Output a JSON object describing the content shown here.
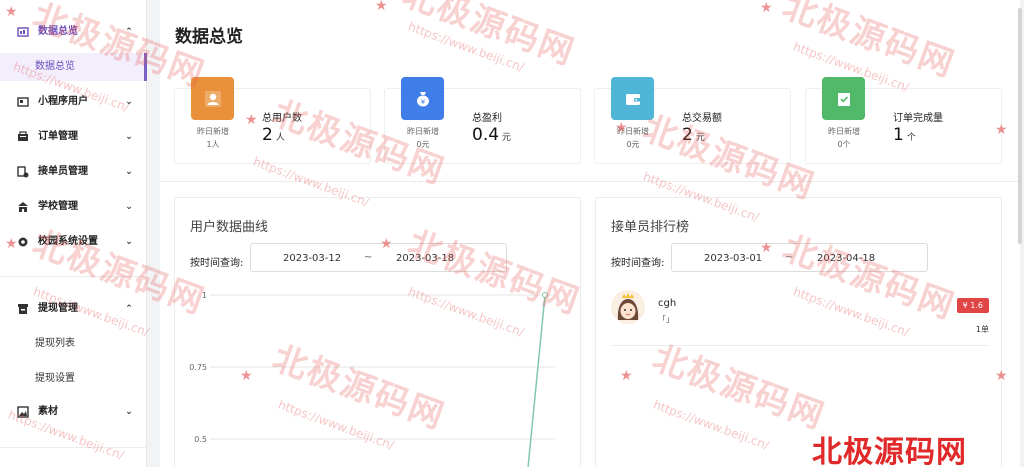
{
  "sidebar": {
    "dashboard_label": "数据总览",
    "dashboard_sub_label": "数据总览",
    "mini_users_label": "小程序用户",
    "orders_label": "订单管理",
    "couriers_label": "接单员管理",
    "schools_label": "学校管理",
    "campus_settings_label": "校园系统设置",
    "withdraw_label": "提现管理",
    "withdraw_list_label": "提现列表",
    "withdraw_settings_label": "提现设置",
    "materials_label": "素材"
  },
  "page": {
    "title": "数据总览"
  },
  "stats": [
    {
      "title": "总用户数",
      "value": "2",
      "unit": "人",
      "sub_label": "昨日新增",
      "sub_value": "1人",
      "color": "#e8913a",
      "icon": "user-icon"
    },
    {
      "title": "总盈利",
      "value": "0.4",
      "unit": "元",
      "sub_label": "昨日新增",
      "sub_value": "0元",
      "color": "#3f7ee8",
      "icon": "money-bag-icon"
    },
    {
      "title": "总交易额",
      "value": "2",
      "unit": "元",
      "sub_label": "昨日新增",
      "sub_value": "0元",
      "color": "#4fb6d8",
      "icon": "wallet-icon"
    },
    {
      "title": "订单完成量",
      "value": "1",
      "unit": "个",
      "sub_label": "昨日新增",
      "sub_value": "0个",
      "color": "#52b96a",
      "icon": "order-bag-icon"
    }
  ],
  "user_chart": {
    "title": "用户数据曲线",
    "query_label": "按时间查询:",
    "date_start": "2023-03-12",
    "date_separator": "~",
    "date_end": "2023-03-18"
  },
  "chart_data": {
    "type": "line",
    "title": "",
    "yticks": [
      "1",
      "0.75",
      "0.5"
    ],
    "ylim": [
      0.5,
      1
    ],
    "series": [
      {
        "values": [
          0,
          0,
          0,
          0,
          0,
          0,
          1
        ]
      }
    ],
    "color": "#7fc8a9"
  },
  "ranking": {
    "title": "接单员排行榜",
    "query_label": "按时间查询:",
    "date_start": "2023-03-01",
    "date_separator": "~",
    "date_end": "2023-04-18",
    "items": [
      {
        "name": "cgh",
        "sub": "「」",
        "amount": "¥ 1.6",
        "count": "1单"
      }
    ]
  },
  "watermark": {
    "brand": "北极源码网",
    "url": "https://www.beiji.cn/"
  }
}
